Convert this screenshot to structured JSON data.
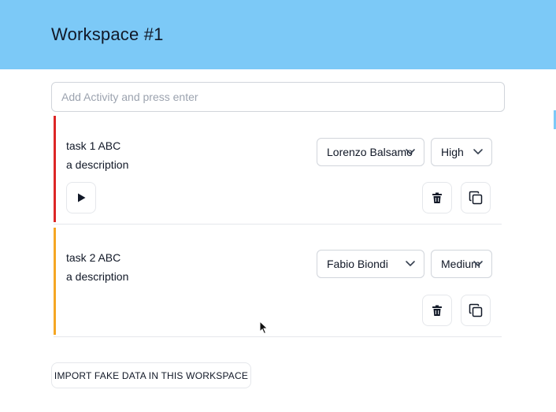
{
  "header": {
    "title": "Workspace #1"
  },
  "add_activity": {
    "placeholder": "Add Activity and press enter",
    "value": ""
  },
  "tasks": [
    {
      "title": "task 1 ABC",
      "description": "a description",
      "assignee": "Lorenzo Balsamo",
      "priority": "High",
      "stripe_color": "#dc2626",
      "has_play": true
    },
    {
      "title": "task 2 ABC",
      "description": "a description",
      "assignee": "Fabio Biondi",
      "priority": "Medium",
      "stripe_color": "#f5a623",
      "has_play": false
    }
  ],
  "icons": {
    "play": "play-icon",
    "delete": "trash-icon",
    "duplicate": "copy-icon",
    "dropdown": "chevron-down-icon"
  },
  "import_button": {
    "label": "IMPORT FAKE DATA IN THIS WORKSPACE"
  }
}
